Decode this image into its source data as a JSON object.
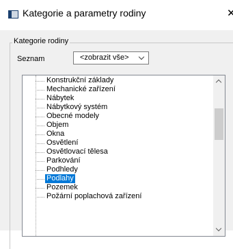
{
  "window": {
    "title": "Kategorie a parametry rodiny"
  },
  "group": {
    "legend": "Kategorie rodiny"
  },
  "filter": {
    "label": "Seznam",
    "selected": "<zobrazit vše>"
  },
  "tree": {
    "items": [
      "Konstrukční základy",
      "Mechanické zařízení",
      "Nábytek",
      "Nábytkový systém",
      "Obecné modely",
      "Objem",
      "Okna",
      "Osvětlení",
      "Osvětlovací tělesa",
      "Parkování",
      "Podhledy",
      "Podlahy",
      "Pozemek",
      "Požární poplachová zařízení"
    ],
    "selected_item": "Podlahy"
  },
  "icons": {
    "app": "window-icon",
    "close": "close-icon",
    "combo_arrow": "chevron-down-icon",
    "scroll_up": "chevron-up-icon",
    "scroll_down": "chevron-down-icon"
  },
  "colors": {
    "selection": "#0078d7",
    "dialog_background": "#f0f0f0"
  }
}
